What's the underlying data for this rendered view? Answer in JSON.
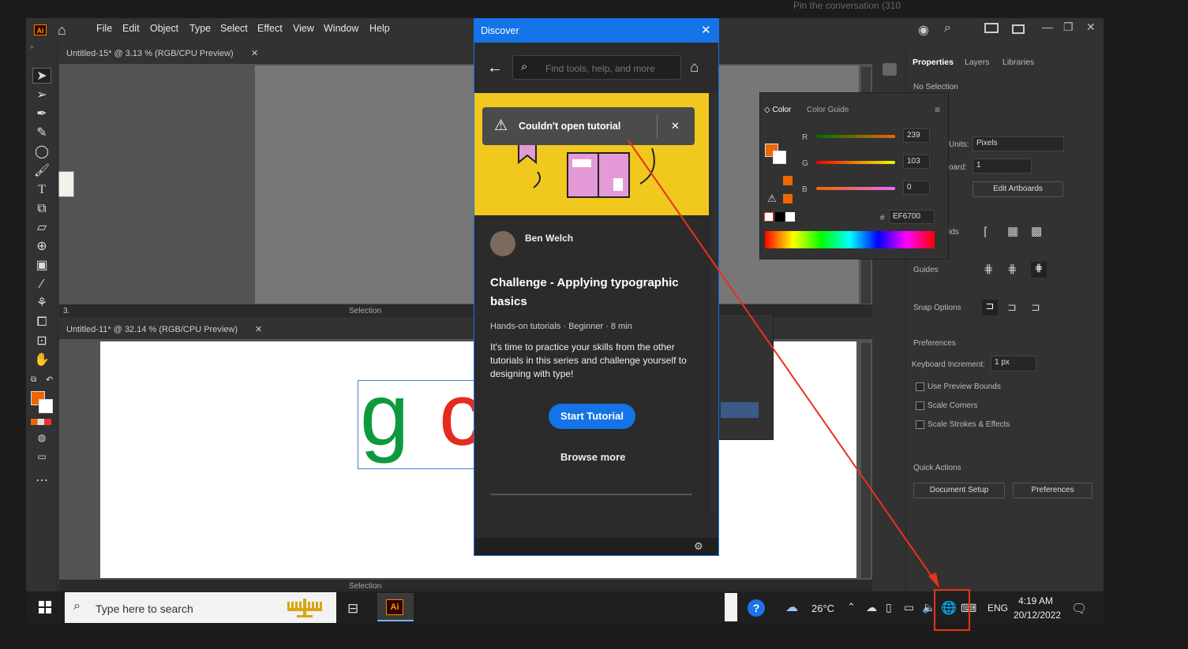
{
  "menubar": {
    "items": [
      "File",
      "Edit",
      "Object",
      "Type",
      "Select",
      "Effect",
      "View",
      "Window",
      "Help"
    ],
    "app_icon": "Ai"
  },
  "doc1": {
    "tab": "Untitled-15* @ 3.13 % (RGB/CPU Preview)",
    "zoom": "3.",
    "status": "Selection"
  },
  "doc2": {
    "tab": "Untitled-11* @ 32.14 % (RGB/CPU Preview)",
    "status": "Selection",
    "text_g": "g",
    "text_o": "c"
  },
  "discover": {
    "title": "Discover",
    "search_placeholder": "Find tools, help, and more",
    "toast": "Couldn't open tutorial",
    "author": "Ben Welch",
    "tutorial_title": "Challenge - Applying typographic basics",
    "meta_type": "Hands-on tutorials",
    "meta_level": "Beginner",
    "meta_time": "8 min",
    "meta_sep": "·",
    "description": "It's time to practice your skills from the other tutorials in this series and challenge yourself to designing with type!",
    "start_button": "Start Tutorial",
    "browse_more": "Browse more"
  },
  "properties": {
    "tabs": [
      "Properties",
      "Layers",
      "Libraries"
    ],
    "no_selection": "No Selection",
    "units_label": "Units:",
    "units_value": "Pixels",
    "artboard_label": "oard:",
    "artboard_value": "1",
    "edit_artboards": "Edit Artboards",
    "grids_label": "ids",
    "guides_label": "Guides",
    "snap_label": "Snap Options",
    "preferences_header": "Preferences",
    "keyboard_increment_label": "Keyboard Increment:",
    "keyboard_increment_value": "1 px",
    "checkboxes": [
      "Use Preview Bounds",
      "Scale Corners",
      "Scale Strokes & Effects"
    ],
    "quick_actions": "Quick Actions",
    "doc_setup": "Document Setup",
    "prefs_button": "Preferences"
  },
  "color_panel": {
    "tabs": [
      "Color",
      "Color Guide"
    ],
    "r_label": "R",
    "r_value": "239",
    "g_label": "G",
    "g_value": "103",
    "b_label": "B",
    "b_value": "0",
    "hex_label": "#",
    "hex_value": "EF6700",
    "fill_color": "#EF6700"
  },
  "taskbar": {
    "search_placeholder": "Type here to search",
    "app_label": "Ai",
    "weather": "26°C",
    "language": "ENG",
    "time": "4:19 AM",
    "date": "20/12/2022"
  },
  "top_text": "Pin the conversation (310"
}
